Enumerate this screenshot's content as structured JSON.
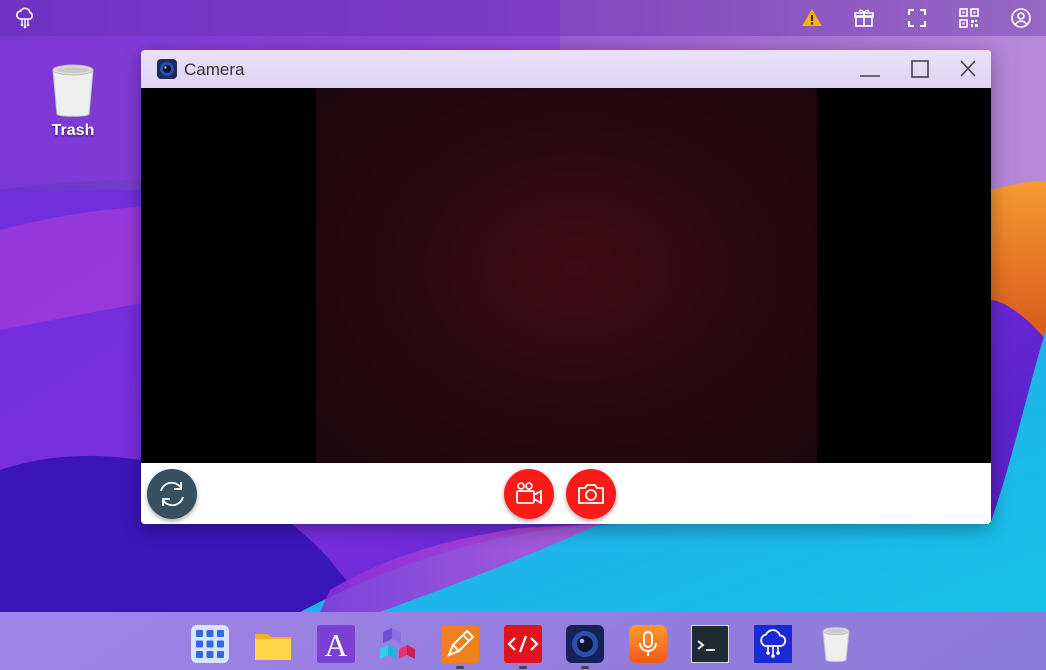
{
  "desktop": {
    "trash_label": "Trash"
  },
  "topbar": {
    "icons": [
      "cloud-network-icon",
      "warning-icon",
      "gift-icon",
      "fullscreen-icon",
      "qr-code-icon",
      "user-account-icon"
    ]
  },
  "window": {
    "title": "Camera",
    "controls": [
      "minimize-icon",
      "maximize-icon",
      "close-icon"
    ]
  },
  "camera": {
    "buttons": [
      "switch-camera-icon",
      "record-video-icon",
      "take-photo-icon"
    ]
  },
  "dock": {
    "items": [
      "app-grid-icon",
      "files-icon",
      "text-editor-icon",
      "blocks-icon",
      "paint-icon",
      "code-editor-icon",
      "camera-icon",
      "voice-recorder-icon",
      "terminal-icon",
      "cloud-network-icon",
      "trash-icon"
    ]
  },
  "colors": {
    "accent_red": "#ff1a1a",
    "switch_button": "#37505f",
    "feed": "#2b0911"
  }
}
